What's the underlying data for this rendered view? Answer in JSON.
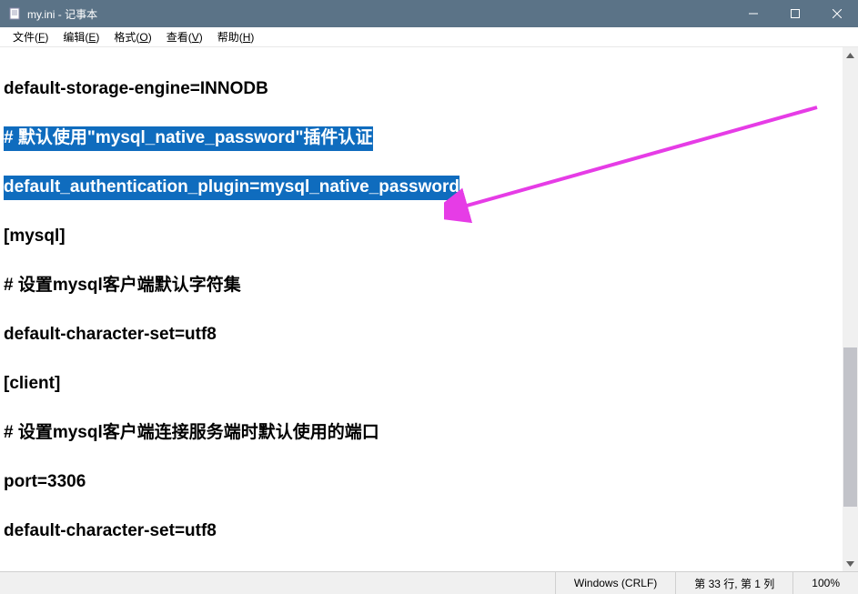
{
  "window": {
    "title": "my.ini - 记事本"
  },
  "menu": {
    "file": "文件(F)",
    "edit": "编辑(E)",
    "format": "格式(O)",
    "view": "查看(V)",
    "help": "帮助(H)"
  },
  "content": {
    "line1": "default-storage-engine=INNODB",
    "line2": "",
    "line3": "# 默认使用\"mysql_native_password\"插件认证",
    "line4": "",
    "line5": "default_authentication_plugin=mysql_native_password",
    "line6": "",
    "line7": "[mysql]",
    "line8": "",
    "line9": "# 设置mysql客户端默认字符集",
    "line10": "",
    "line11": "default-character-set=utf8",
    "line12": "",
    "line13": "[client]",
    "line14": "",
    "line15": "# 设置mysql客户端连接服务端时默认使用的端口",
    "line16": "",
    "line17": "port=3306",
    "line18": "",
    "line19": "default-character-set=utf8"
  },
  "statusbar": {
    "encoding": "Windows (CRLF)",
    "position": "第 33 行, 第 1 列",
    "zoom": "100%"
  }
}
